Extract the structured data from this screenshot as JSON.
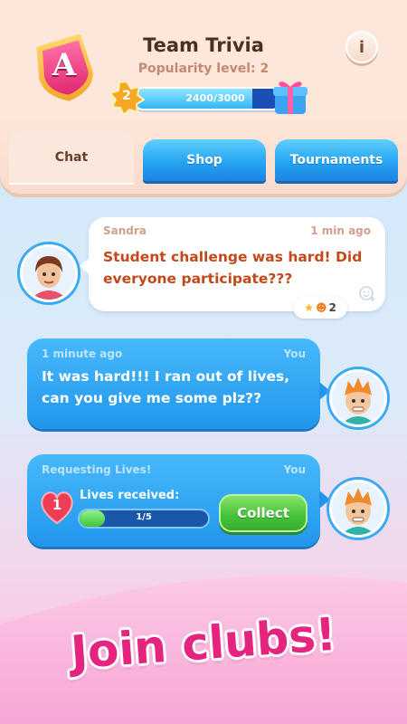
{
  "header": {
    "team_name": "Team Trivia",
    "popularity": "Popularity level: 2",
    "badge_letter": "A",
    "info_label": "i",
    "level": "2",
    "xp_text": "2400/3000",
    "xp_progress": 0.8
  },
  "tabs": [
    {
      "label": "Chat",
      "active": true
    },
    {
      "label": "Shop",
      "active": false
    },
    {
      "label": "Tournaments",
      "active": false
    }
  ],
  "messages": [
    {
      "sender": "Sandra",
      "time": "1 min ago",
      "text": "Student challenge was hard! Did everyone participate???",
      "reactions": "2"
    },
    {
      "sender": "You",
      "time": "1 minute ago",
      "text": "It was hard!!! I ran out of lives, can you give me some plz??"
    },
    {
      "sender": "You",
      "title": "Requesting Lives!",
      "lives_count": "1",
      "lives_label": "Lives received:",
      "lives_progress_text": "1/5",
      "lives_progress": 0.2,
      "button": "Collect"
    }
  ],
  "promo": {
    "text": "Join clubs!"
  },
  "colors": {
    "accent_blue": "#2296ec",
    "accent_pink": "#e4247f",
    "collect_green": "#46c43b"
  }
}
